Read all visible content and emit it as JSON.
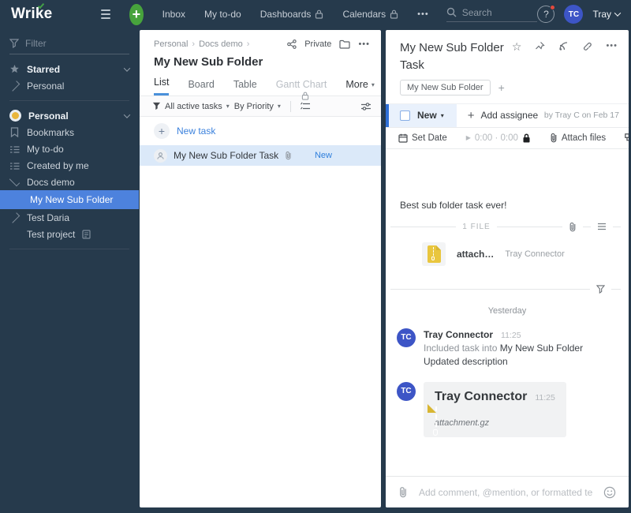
{
  "colors": {
    "navy": "#263a4c",
    "accent_blue": "#3c82dd",
    "selection_blue": "#4d82dd",
    "row_highlight": "#dbe9f9",
    "status_bg": "#e9f1fc",
    "status_bar": "#2f6fd6",
    "green_plus": "#47a33c",
    "avatar_blue": "#3d55c6",
    "zip_gold": "#e9c63e",
    "alert_red": "#e2493d"
  },
  "icons": {
    "more": "•••",
    "caret": "▾",
    "play": "▶",
    "star": "☆",
    "crumb_sep": "›",
    "plus": "+"
  },
  "topbar": {
    "logo": "Wrike",
    "nav": [
      {
        "label": "Inbox",
        "locked": false
      },
      {
        "label": "My to-do",
        "locked": false
      },
      {
        "label": "Dashboards",
        "locked": true
      },
      {
        "label": "Calendars",
        "locked": true
      }
    ],
    "search": {
      "placeholder": "Search"
    },
    "help_label": "?",
    "avatar_initials": "TC",
    "user_name": "Tray"
  },
  "sidebar": {
    "filter_placeholder": "Filter",
    "starred": {
      "label": "Starred",
      "child": "Personal"
    },
    "space": {
      "label": "Personal"
    },
    "items": [
      {
        "label": "Bookmarks"
      },
      {
        "label": "My to-do"
      },
      {
        "label": "Created by me"
      },
      {
        "label": "Docs demo"
      },
      {
        "label": "My New Sub Folder"
      },
      {
        "label": "Test Daria"
      },
      {
        "label": "Test project"
      }
    ]
  },
  "list_panel": {
    "breadcrumb": [
      "Personal",
      "Docs demo"
    ],
    "privacy_label": "Private",
    "title": "My New Sub Folder",
    "tabs": [
      {
        "label": "List"
      },
      {
        "label": "Board"
      },
      {
        "label": "Table"
      },
      {
        "label": "Gantt Chart"
      },
      {
        "label": "More"
      }
    ],
    "filters": {
      "active_filter": "All active tasks",
      "sort": "By Priority"
    },
    "new_task_label": "New task",
    "tasks": [
      {
        "title": "My New Sub Folder Task",
        "status": "New"
      }
    ]
  },
  "detail_panel": {
    "title": "My New Sub Folder Task",
    "tag": "My New Sub Folder",
    "status_label": "New",
    "add_assignee_label": "Add assignee",
    "byline": "by Tray C on Feb 17",
    "toolbar": {
      "set_date": "Set Date",
      "time": "0:00 · 0:00",
      "attach": "Attach files",
      "dependency": "Add dependency"
    },
    "description": "Best sub folder task ever!",
    "files": {
      "divider_label": "1 FILE",
      "items": [
        {
          "name": "attach…",
          "author": "Tray Connector"
        }
      ]
    },
    "activity": {
      "day_label": "Yesterday",
      "entries": [
        {
          "avatar": "TC",
          "author": "Tray Connector",
          "time": "11:25",
          "line1_prefix": "Included task into ",
          "line1_target": "My New Sub Folder",
          "line2": "Updated description"
        },
        {
          "avatar": "TC",
          "author": "Tray Connector",
          "time": "11:25",
          "attachment_name": "attachment.gz"
        }
      ]
    },
    "comment": {
      "placeholder": "Add comment, @mention, or formatted text"
    }
  }
}
